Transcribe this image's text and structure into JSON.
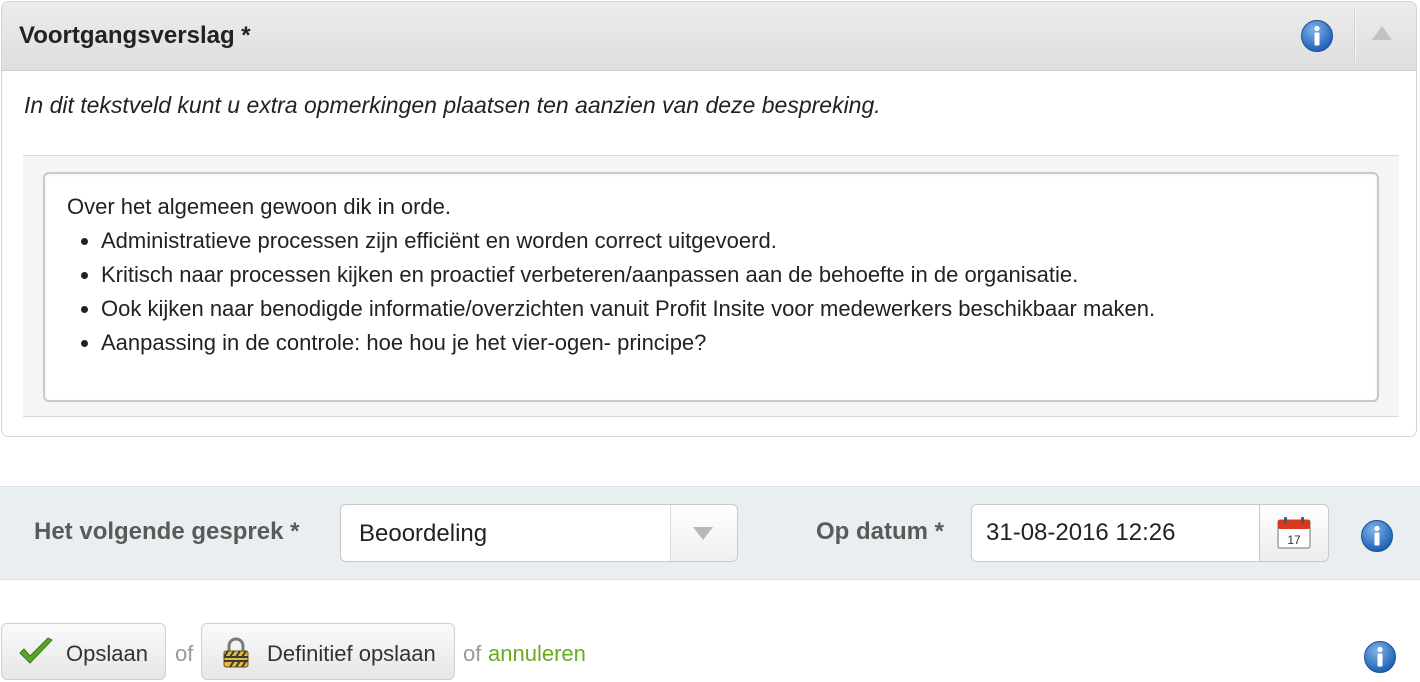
{
  "panel": {
    "title": "Voortgangsverslag *",
    "description": "In dit tekstveld kunt u extra opmerkingen plaatsen ten aanzien van deze bespreking.",
    "info_icon": "info-icon",
    "collapse_icon": "collapse-up-icon",
    "editor": {
      "intro": "Over het algemeen gewoon dik in orde.",
      "bullets": [
        "Administratieve processen zijn efficiënt en worden correct uitgevoerd.",
        "Kritisch naar processen kijken en proactief verbeteren/aanpassen aan de behoefte in de organisatie.",
        "Ook kijken naar benodigde informatie/overzichten vanuit Profit Insite voor medewerkers beschikbaar maken.",
        "Aanpassing in de controle: hoe hou je het vier-ogen- principe?"
      ]
    }
  },
  "next": {
    "label": "Het volgende gesprek *",
    "selected": "Beoordeling",
    "date_label": "Op datum *",
    "date_value": "31-08-2016 12:26",
    "calendar_day": "17"
  },
  "actions": {
    "save_label": "Opslaan",
    "of1": "of",
    "final_label": "Definitief opslaan",
    "of2": "of",
    "cancel_label": "annuleren"
  },
  "colors": {
    "info_blue": "#1d5fb3",
    "link_green": "#6aaa1e",
    "check_green": "#58a52a",
    "calendar_red": "#d9381e"
  }
}
